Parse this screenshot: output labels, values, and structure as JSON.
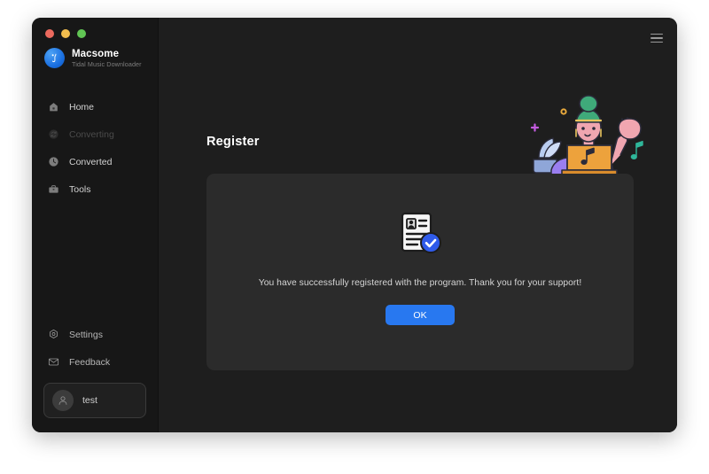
{
  "window": {
    "traffic_lights": [
      {
        "name": "close",
        "color": "#ec6a5e"
      },
      {
        "name": "minimize",
        "color": "#f3bd4e"
      },
      {
        "name": "maximize",
        "color": "#61c554"
      }
    ]
  },
  "brand": {
    "title": "Macsome",
    "subtitle": "Tidal Music Downloader",
    "logo_icon": "tidal-wave-icon",
    "logo_color": "#1a6fe0"
  },
  "sidebar": {
    "top_items": [
      {
        "label": "Home",
        "icon": "home-icon",
        "state": "normal",
        "name": "sidebar-item-home"
      },
      {
        "label": "Converting",
        "icon": "refresh-icon",
        "state": "disabled",
        "name": "sidebar-item-converting"
      },
      {
        "label": "Converted",
        "icon": "clock-icon",
        "state": "normal",
        "name": "sidebar-item-converted"
      },
      {
        "label": "Tools",
        "icon": "toolbox-icon",
        "state": "normal",
        "name": "sidebar-item-tools"
      }
    ],
    "bottom_items": [
      {
        "label": "Settings",
        "icon": "gear-icon",
        "state": "normal",
        "name": "sidebar-item-settings"
      },
      {
        "label": "Feedback",
        "icon": "envelope-icon",
        "state": "normal",
        "name": "sidebar-item-feedback"
      }
    ],
    "account": {
      "name": "test",
      "avatar_icon": "person-icon"
    }
  },
  "header": {
    "menu_icon": "hamburger-menu-icon"
  },
  "main": {
    "page_title": "Register",
    "illustration": {
      "name": "woman-waving-with-laptop-illustration",
      "colors": {
        "hair": "#3faa7a",
        "skin": "#f0a6b0",
        "shirt": "#7b5ce0",
        "laptop": "#eda23c",
        "plant": "#b9cdf0",
        "sparkle": "#c45ce0",
        "dot": "#e8a93c",
        "music_note": "#2fb79a"
      }
    },
    "card": {
      "status_icon": "registration-card-verified-icon",
      "message": "You have successfully registered with the program. Thank you for your support!",
      "ok_label": "OK",
      "ok_color": "#2878f0"
    }
  }
}
